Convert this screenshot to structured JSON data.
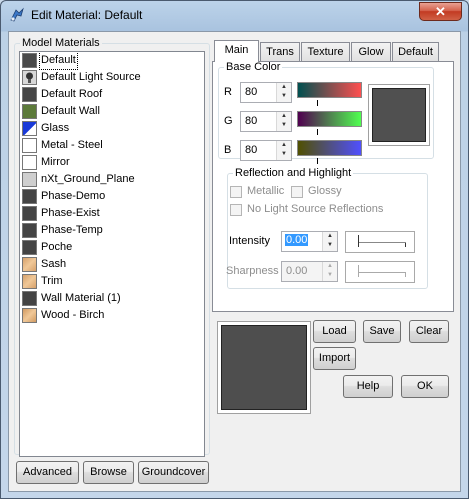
{
  "window": {
    "title": "Edit Material: Default",
    "close_label": "✕"
  },
  "model_materials": {
    "legend": "Model Materials",
    "items": [
      {
        "label": "Default",
        "color": "#4a4a4a",
        "selected": true
      },
      {
        "label": "Default Light Source",
        "color": "#3a3a3a",
        "icon": "lightbulb-icon"
      },
      {
        "label": "Default Roof",
        "color": "#464646"
      },
      {
        "label": "Default Wall",
        "color": "#5c7a3a"
      },
      {
        "label": "Glass",
        "color": "#1a3ad8",
        "icon": "glass-icon"
      },
      {
        "label": "Metal - Steel",
        "color": "#ffffff"
      },
      {
        "label": "Mirror",
        "color": "#ffffff"
      },
      {
        "label": "nXt_Ground_Plane",
        "color": "#cfcfcf"
      },
      {
        "label": "Phase-Demo",
        "color": "#444444"
      },
      {
        "label": "Phase-Exist",
        "color": "#444444"
      },
      {
        "label": "Phase-Temp",
        "color": "#444444"
      },
      {
        "label": "Poche",
        "color": "#444444"
      },
      {
        "label": "Sash",
        "color": "#d7a16b",
        "icon": "texture-icon"
      },
      {
        "label": "Trim",
        "color": "#d7a16b",
        "icon": "texture-icon"
      },
      {
        "label": "Wall Material (1)",
        "color": "#444444"
      },
      {
        "label": "Wood - Birch",
        "color": "#d19a61",
        "icon": "texture-icon"
      }
    ]
  },
  "left_buttons": {
    "advanced": "Advanced",
    "browse": "Browse",
    "groundcover": "Groundcover"
  },
  "tabs": [
    "Main",
    "Trans",
    "Texture",
    "Glow",
    "Default"
  ],
  "base_color": {
    "legend": "Base Color",
    "channels": [
      {
        "label": "R",
        "value": "80"
      },
      {
        "label": "G",
        "value": "80"
      },
      {
        "label": "B",
        "value": "80"
      }
    ],
    "swatch_color": "#505050"
  },
  "reflection": {
    "legend": "Reflection and Highlight",
    "metallic": "Metallic",
    "glossy": "Glossy",
    "no_light": "No Light Source Reflections",
    "intensity_label": "Intensity",
    "intensity_value": "0.00",
    "sharpness_label": "Sharpness",
    "sharpness_value": "0.00"
  },
  "actions": {
    "load": "Load",
    "save": "Save",
    "clear": "Clear",
    "import": "Import",
    "help": "Help",
    "ok": "OK"
  },
  "preview_color": "#4e4e4e"
}
